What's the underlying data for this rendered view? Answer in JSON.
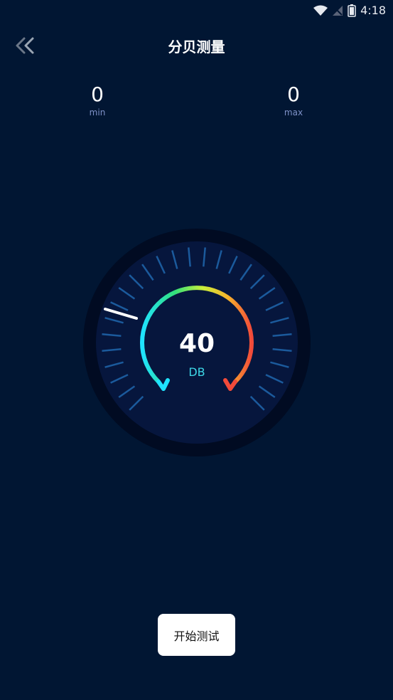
{
  "status_bar": {
    "time": "4:18"
  },
  "header": {
    "title": "分贝测量"
  },
  "stats": {
    "min": {
      "value": "0",
      "label": "min"
    },
    "max": {
      "value": "0",
      "label": "max"
    }
  },
  "gauge": {
    "value": "40",
    "unit": "DB"
  },
  "actions": {
    "start_label": "开始测试"
  },
  "colors": {
    "background": "#011633",
    "gauge_face": "#06163d",
    "gauge_rim": "#010b22",
    "tick": "#1b5a9c",
    "needle": "#ffffff",
    "unit": "#3dd7e6"
  }
}
